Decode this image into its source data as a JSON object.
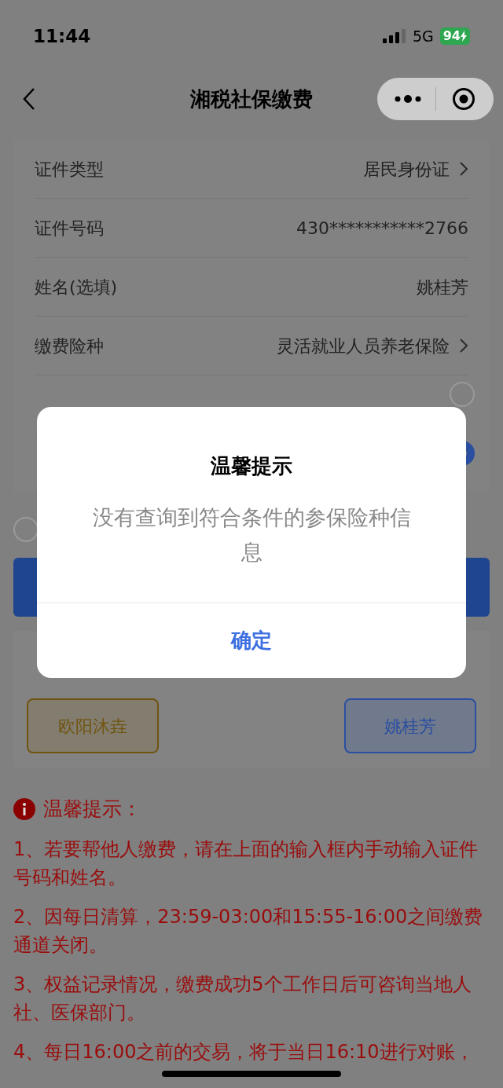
{
  "status_bar": {
    "time": "11:44",
    "network": "5G",
    "battery": "94"
  },
  "nav": {
    "title": "湘税社保缴费"
  },
  "form": {
    "rows": [
      {
        "label": "证件类型",
        "value": "居民身份证",
        "kind": "select"
      },
      {
        "label": "证件号码",
        "value": "430***********2766",
        "kind": "text"
      },
      {
        "label": "姓名(选填)",
        "value": "姚桂芳",
        "kind": "text"
      },
      {
        "label": "缴费险种",
        "value": "灵活就业人员养老保险",
        "kind": "select"
      }
    ],
    "payment_options": [
      {
        "selected": false
      },
      {
        "selected": true
      }
    ]
  },
  "agreement": {
    "checked": false
  },
  "quick_select": {
    "people": [
      {
        "name": "欧阳沐垚",
        "selected": false,
        "color": "#705510"
      },
      {
        "name": "姚桂芳",
        "selected": true,
        "color": "#2a4ea0"
      }
    ]
  },
  "tips": {
    "title": "温馨提示：",
    "items": [
      "1、若要帮他人缴费，请在上面的输入框内手动输入证件号码和姓名。",
      "2、因每日清算，23:59-03:00和15:55-16:00之间缴费通道关闭。",
      "3、权益记录情况，缴费成功5个工作日后可咨询当地人社、医保部门。",
      "4、每日16:00之前的交易，将于当日16:10进行对账，"
    ]
  },
  "dialog": {
    "title": "温馨提示",
    "message": "没有查询到符合条件的参保险种信息",
    "button": "确定"
  }
}
